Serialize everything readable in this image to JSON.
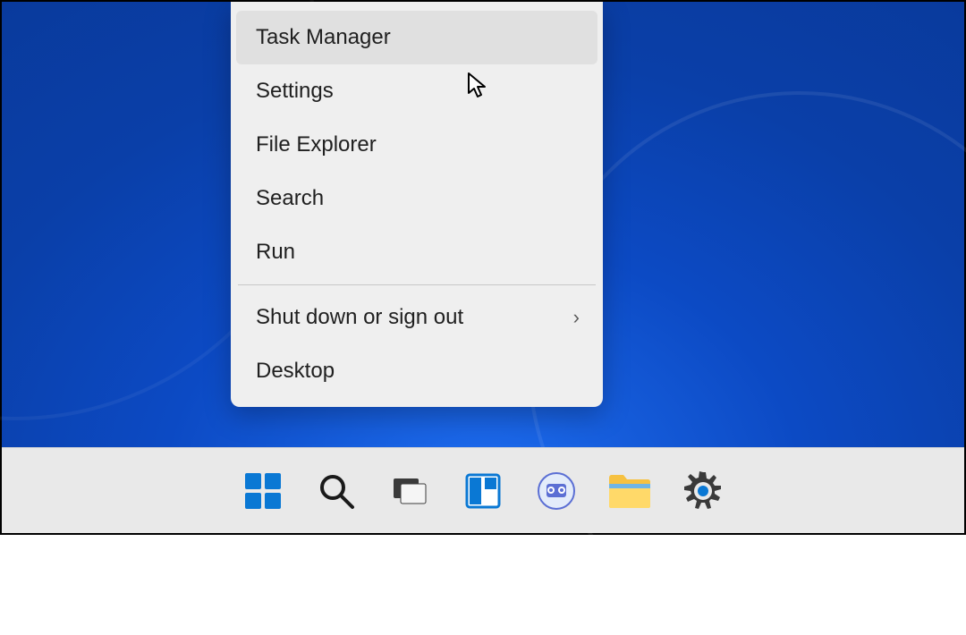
{
  "context_menu": {
    "group1": [
      {
        "label": "Task Manager",
        "hovered": true,
        "submenu": false
      },
      {
        "label": "Settings",
        "hovered": false,
        "submenu": false
      },
      {
        "label": "File Explorer",
        "hovered": false,
        "submenu": false
      },
      {
        "label": "Search",
        "hovered": false,
        "submenu": false
      },
      {
        "label": "Run",
        "hovered": false,
        "submenu": false
      }
    ],
    "group2": [
      {
        "label": "Shut down or sign out",
        "hovered": false,
        "submenu": true
      },
      {
        "label": "Desktop",
        "hovered": false,
        "submenu": false
      }
    ]
  },
  "taskbar": {
    "items": [
      {
        "name": "start-icon"
      },
      {
        "name": "search-icon"
      },
      {
        "name": "task-view-icon"
      },
      {
        "name": "widgets-icon"
      },
      {
        "name": "chat-icon"
      },
      {
        "name": "file-explorer-icon"
      },
      {
        "name": "settings-icon"
      }
    ]
  }
}
